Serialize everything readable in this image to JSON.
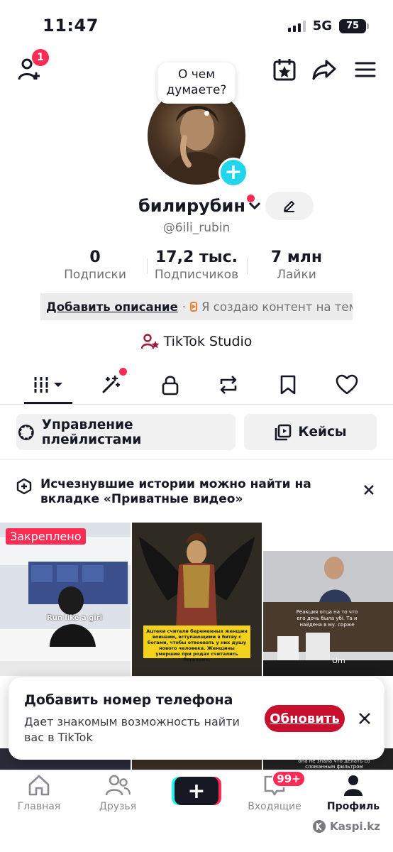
{
  "status_bar": {
    "time": "11:47",
    "network": "5G",
    "battery": "75"
  },
  "header": {
    "friend_requests_badge": "1"
  },
  "profile": {
    "thought_bubble": "О чем думаете?",
    "display_name": "билирубин",
    "handle": "@6ili_rubin"
  },
  "stats": [
    {
      "value": "0",
      "label": "Подписки"
    },
    {
      "value": "17,2 тыс.",
      "label": "Подписчиков"
    },
    {
      "value": "7 млн",
      "label": "Лайки"
    }
  ],
  "description": {
    "add_label": "Добавить описание",
    "separator": "·",
    "creator_text": "Я создаю контент на тему"
  },
  "studio": {
    "label": "TikTok Studio"
  },
  "tabs": [
    "videos",
    "reposts-sparkle",
    "private",
    "reposts",
    "favorites",
    "liked"
  ],
  "buttons": {
    "playlists": "Управление плейлистами",
    "cases": "Кейсы"
  },
  "notice": {
    "text": "Исчезнувшие истории можно найти на вкладке «Приватные видео»"
  },
  "grid": {
    "pinned_label": "Закреплено",
    "tiles": [
      {
        "caption": "Run like a girl"
      },
      {
        "caption": "Ацтеки считали беременных женщин воинами, вступающими в битву с богами, чтобы отвоевать у них душу нового человека. Женщины умершие при родах считались богинями."
      },
      {
        "caption": "Реакция отца на то что его дочь была убі. Та и найдена в му. сорже",
        "extra": "Um"
      }
    ],
    "row2_caption": "она не знала что делать со сломанным фильтром"
  },
  "toast": {
    "title": "Добавить номер телефона",
    "body": "Дает знакомым возможность найти вас в TikTok",
    "action": "Обновить"
  },
  "bottom_nav": {
    "home": "Главная",
    "friends": "Друзья",
    "inbox": "Входящие",
    "inbox_badge": "99+",
    "profile": "Профиль"
  },
  "watermark": "Kaspi.kz",
  "colors": {
    "accent": "#fe2c55",
    "cyan": "#20d5ec",
    "text": "#161823",
    "muted": "#6f7073"
  }
}
